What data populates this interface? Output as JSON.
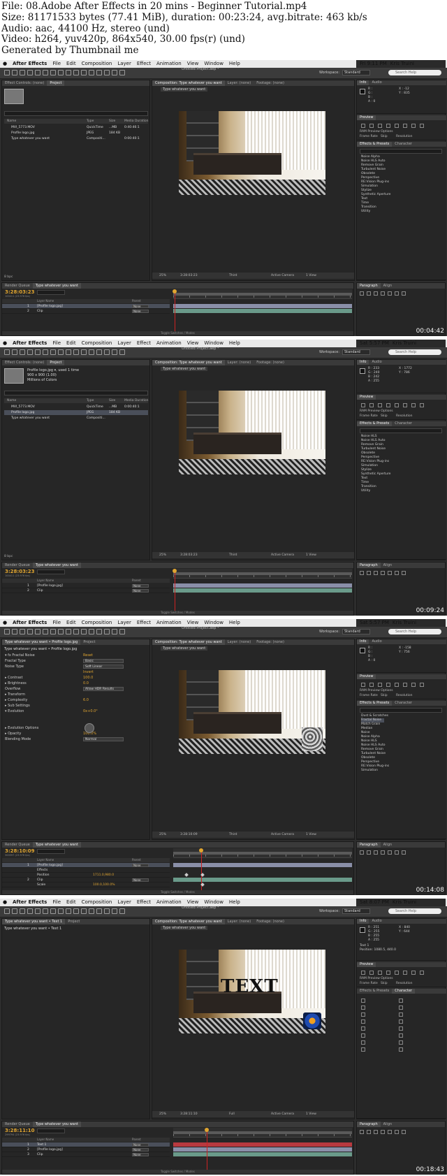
{
  "header": {
    "lines": [
      "File: 08.Adobe After Effects in 20 mins - Beginner Tutorial.mp4",
      "Size: 81171533 bytes (77.41 MiB), duration: 00:23:24, avg.bitrate: 463 kb/s",
      "Audio: aac, 44100 Hz, stereo (und)",
      "Video: h264, yuv420p, 864x540, 30.00 fps(r) (und)",
      "Generated by Thumbnail me"
    ]
  },
  "common": {
    "apple": "",
    "menu": [
      "After Effects",
      "File",
      "Edit",
      "Composition",
      "Layer",
      "Effect",
      "Animation",
      "View",
      "Window",
      "Help"
    ],
    "project_title": "Untitled Project.aep *",
    "workspace_label": "Workspace:",
    "workspace_value": "Standard",
    "search_placeholder": "Search Help",
    "comp_tab": "Composition: Type whatever you want",
    "layer_tab": "Layer: (none)",
    "footage_tab": "Footage: (none)",
    "comp_name": "Type whatever you want",
    "render_queue": "Render Queue",
    "timeline_tab": "Type whatever you want",
    "info_tab": "Info",
    "audio_tab": "Audio",
    "preview_tab": "Preview",
    "ram_preview": "RAM Preview Options",
    "frame_rate": "Frame Rate",
    "skip": "Skip",
    "resolution": "Resolution",
    "effects_tab": "Effects & Presets",
    "character_tab": "Character",
    "paragraph_tab": "Paragraph",
    "align_tab": "Align",
    "toggle": "Toggle Switches / Modes",
    "col_name": "Name",
    "col_type": "Type",
    "col_size": "Size",
    "col_media": "Media Duration",
    "col_layer": "Layer Name",
    "col_parent": "Parent",
    "zoom": "25%",
    "view_third": "Third",
    "view_full": "Full",
    "active_camera": "Active Camera",
    "one_view": "1 View",
    "parent_none": "None",
    "project_tab": "Project",
    "fx_controls_tab": "Effect Controls: (none)",
    "bpc": "8 bpc"
  },
  "frames": [
    {
      "timestamp": "00:04:42",
      "clock": "Fri 9:11 PM",
      "user": "Kris Truini",
      "timecode": "3:28:03:23",
      "fps": "100411 (23.976 fps)",
      "comp_time": "3:28:03:23",
      "left_mode": "project",
      "project_items": [
        {
          "name": "MVI_5773.MOV",
          "type": "QuickTime",
          "size": "...MB",
          "dur": "0:40:46:1",
          "sel": false
        },
        {
          "name": "Profile logo.jpg",
          "type": "JPEG",
          "size": "184 KB",
          "dur": "",
          "sel": false
        },
        {
          "name": "Type whatever you want",
          "type": "Compositi...",
          "size": "",
          "dur": "0:00:40:1",
          "sel": false
        }
      ],
      "project_info": [],
      "layers": [
        {
          "n": "1",
          "name": "[Profile logo.jpg]",
          "sel": true
        },
        {
          "n": "2",
          "name": "Clip",
          "sel": false
        }
      ],
      "overlay": "none",
      "info_text": "R :\nG :\nB :\nA : 0",
      "info_xy": "X : -12\nY : 835",
      "effects": [
        "Noise Alpha",
        "Noise HLS Auto",
        "Remove Grain",
        "Turbulent Noise",
        "Obsolete",
        "Perspective",
        "RE:Vision Plug-ins",
        "Simulation",
        "Stylize",
        "Synthetic Aperture",
        "Text",
        "Time",
        "Transition",
        "Utility"
      ],
      "effect_sel": -1
    },
    {
      "timestamp": "00:09:24",
      "clock": "Sat 5:57 PM",
      "user": "Kris Truini",
      "timecode": "3:28:03:23",
      "fps": "100411 (23.976 fps)",
      "comp_time": "3:28:03:23",
      "left_mode": "project",
      "project_items": [
        {
          "name": "MVI_5773.MOV",
          "type": "QuickTime",
          "size": "...MB",
          "dur": "0:00:40:1",
          "sel": false
        },
        {
          "name": "Profile logo.jpg",
          "type": "JPEG",
          "size": "184 KB",
          "dur": "",
          "sel": true
        },
        {
          "name": "Type whatever you want",
          "type": "Compositi...",
          "size": "",
          "dur": "",
          "sel": false
        }
      ],
      "project_info": [
        "Profile logo.jpg ▾, used 1 time",
        "900 x 900 (1.00)",
        "",
        "Millions of Colors"
      ],
      "layers": [
        {
          "n": "1",
          "name": "[Profile logo.jpg]",
          "sel": false
        },
        {
          "n": "2",
          "name": "Clip",
          "sel": false
        }
      ],
      "overlay": "none",
      "info_text": "R : 233\nG : 240\nB : 242\nA : 255",
      "info_xy": "X : 1772\nY : 786",
      "effects": [
        "Noise HLS",
        "Noise HLS Auto",
        "Remove Grain",
        "Turbulent Noise",
        "Obsolete",
        "Perspective",
        "RE:Vision Plug-ins",
        "Simulation",
        "Stylize",
        "Synthetic Aperture",
        "Text",
        "Time",
        "Transition",
        "Utility"
      ],
      "effect_sel": -1
    },
    {
      "timestamp": "00:14:08",
      "clock": "Sat 5:57 PM",
      "user": "Kris Truini",
      "timecode": "3:28:10:09",
      "fps": "300597 (23.976 fps)",
      "comp_time": "3:28:10:09",
      "left_mode": "fx",
      "fx_title": "Type whatever you want • Profile logo.jpg",
      "fx_rows": [
        {
          "lbl": "▾ fx  Fractal Noise",
          "val": "Reset",
          "kind": "val"
        },
        {
          "lbl": "      Fractal Type",
          "val": "Basic",
          "kind": "sel"
        },
        {
          "lbl": "      Noise Type",
          "val": "Soft Linear",
          "kind": "sel"
        },
        {
          "lbl": "",
          "val": "Invert",
          "kind": "val"
        },
        {
          "lbl": "   ▸ Contrast",
          "val": "100.0",
          "kind": "val"
        },
        {
          "lbl": "   ▸ Brightness",
          "val": "0.0",
          "kind": "val"
        },
        {
          "lbl": "      Overflow",
          "val": "Allow HDR Results",
          "kind": "sel"
        },
        {
          "lbl": "   ▸ Transform",
          "val": "",
          "kind": "val"
        },
        {
          "lbl": "   ▸ Complexity",
          "val": "6.0",
          "kind": "val"
        },
        {
          "lbl": "   ▸ Sub Settings",
          "val": "",
          "kind": "val"
        },
        {
          "lbl": "   ▾ Evolution",
          "val": "0x+0.0°",
          "kind": "val"
        },
        {
          "lbl": "",
          "val": "",
          "kind": "val"
        },
        {
          "lbl": "",
          "val": "",
          "kind": "val"
        },
        {
          "lbl": "   ▸ Evolution Options",
          "val": "",
          "kind": "val"
        },
        {
          "lbl": "   ▸ Opacity",
          "val": "100.0%",
          "kind": "val"
        },
        {
          "lbl": "      Blending Mode",
          "val": "Normal",
          "kind": "sel"
        }
      ],
      "layers": [
        {
          "n": "1",
          "name": "[Profile logo.jpg]",
          "sel": true
        },
        {
          "n": "",
          "name": "   Effects",
          "sel": false
        },
        {
          "n": "",
          "name": "   Position",
          "sel": false,
          "val": "1711.0,980.0"
        },
        {
          "n": "2",
          "name": "Clip",
          "sel": false
        },
        {
          "n": "",
          "name": "   Scale",
          "sel": false,
          "val": "100.0,100.0%"
        }
      ],
      "overlay": "fractal",
      "info_text": "R :\nG :\nB :\nA : 0",
      "info_xy": "X : -158\nY : 756",
      "effects": [
        "Dust & Scratches",
        "Fractal Noise",
        "Match Grain",
        "Median",
        "Noise",
        "Noise Alpha",
        "Noise HLS",
        "Noise HLS Auto",
        "Remove Grain",
        "Turbulent Noise",
        "Obsolete",
        "Perspective",
        "RE:Vision Plug-ins",
        "Simulation"
      ],
      "effect_sel": 1
    },
    {
      "timestamp": "00:18:43",
      "clock": "Sat 8:07 PM",
      "user": "Kris Truini",
      "timecode": "3:28:11:10",
      "fps": "299794 (23.976 fps)",
      "comp_time": "3:28:11:10",
      "left_mode": "fx",
      "fx_title": "Type whatever you want • Text 1",
      "fx_rows": [],
      "layers": [
        {
          "n": "1",
          "name": "Text 1",
          "sel": true
        },
        {
          "n": "2",
          "name": "[Profile logo.jpg]",
          "sel": false
        },
        {
          "n": "3",
          "name": "Clip",
          "sel": false
        }
      ],
      "overlay": "text",
      "text_value": "TEXT",
      "info_text": "R : 251\nG : 255\nB : 255\nA : 255",
      "info_xy": "X : 840\nY : 644",
      "info_extra": "Text 1\nPosition: 1080.5, 440.0",
      "effects": [],
      "effect_sel": -1
    }
  ]
}
